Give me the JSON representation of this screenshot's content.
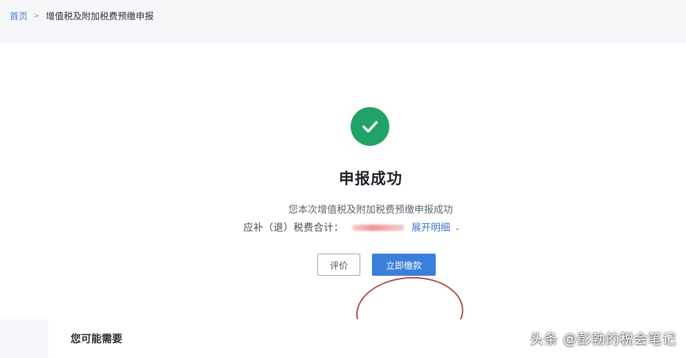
{
  "breadcrumb": {
    "home": "首页",
    "separator": ">",
    "current": "增值税及附加税费预缴申报"
  },
  "result": {
    "icon": "check-circle-icon",
    "title": "申报成功",
    "subtitle": "您本次增值税及附加税费预缴申报成功",
    "total_label": "应补（退）税费合计：",
    "expand_label": "展开明细",
    "expand_icon": "chevron-down-icon"
  },
  "actions": {
    "rate_label": "评价",
    "pay_label": "立即缴款"
  },
  "bottom": {
    "title": "您可能需要"
  },
  "watermark": {
    "text": "头条 @彭勃的税会笔记"
  },
  "colors": {
    "success": "#21a366",
    "primary": "#3a7fdc",
    "link": "#3f73d1",
    "annotation": "#a7332f"
  }
}
